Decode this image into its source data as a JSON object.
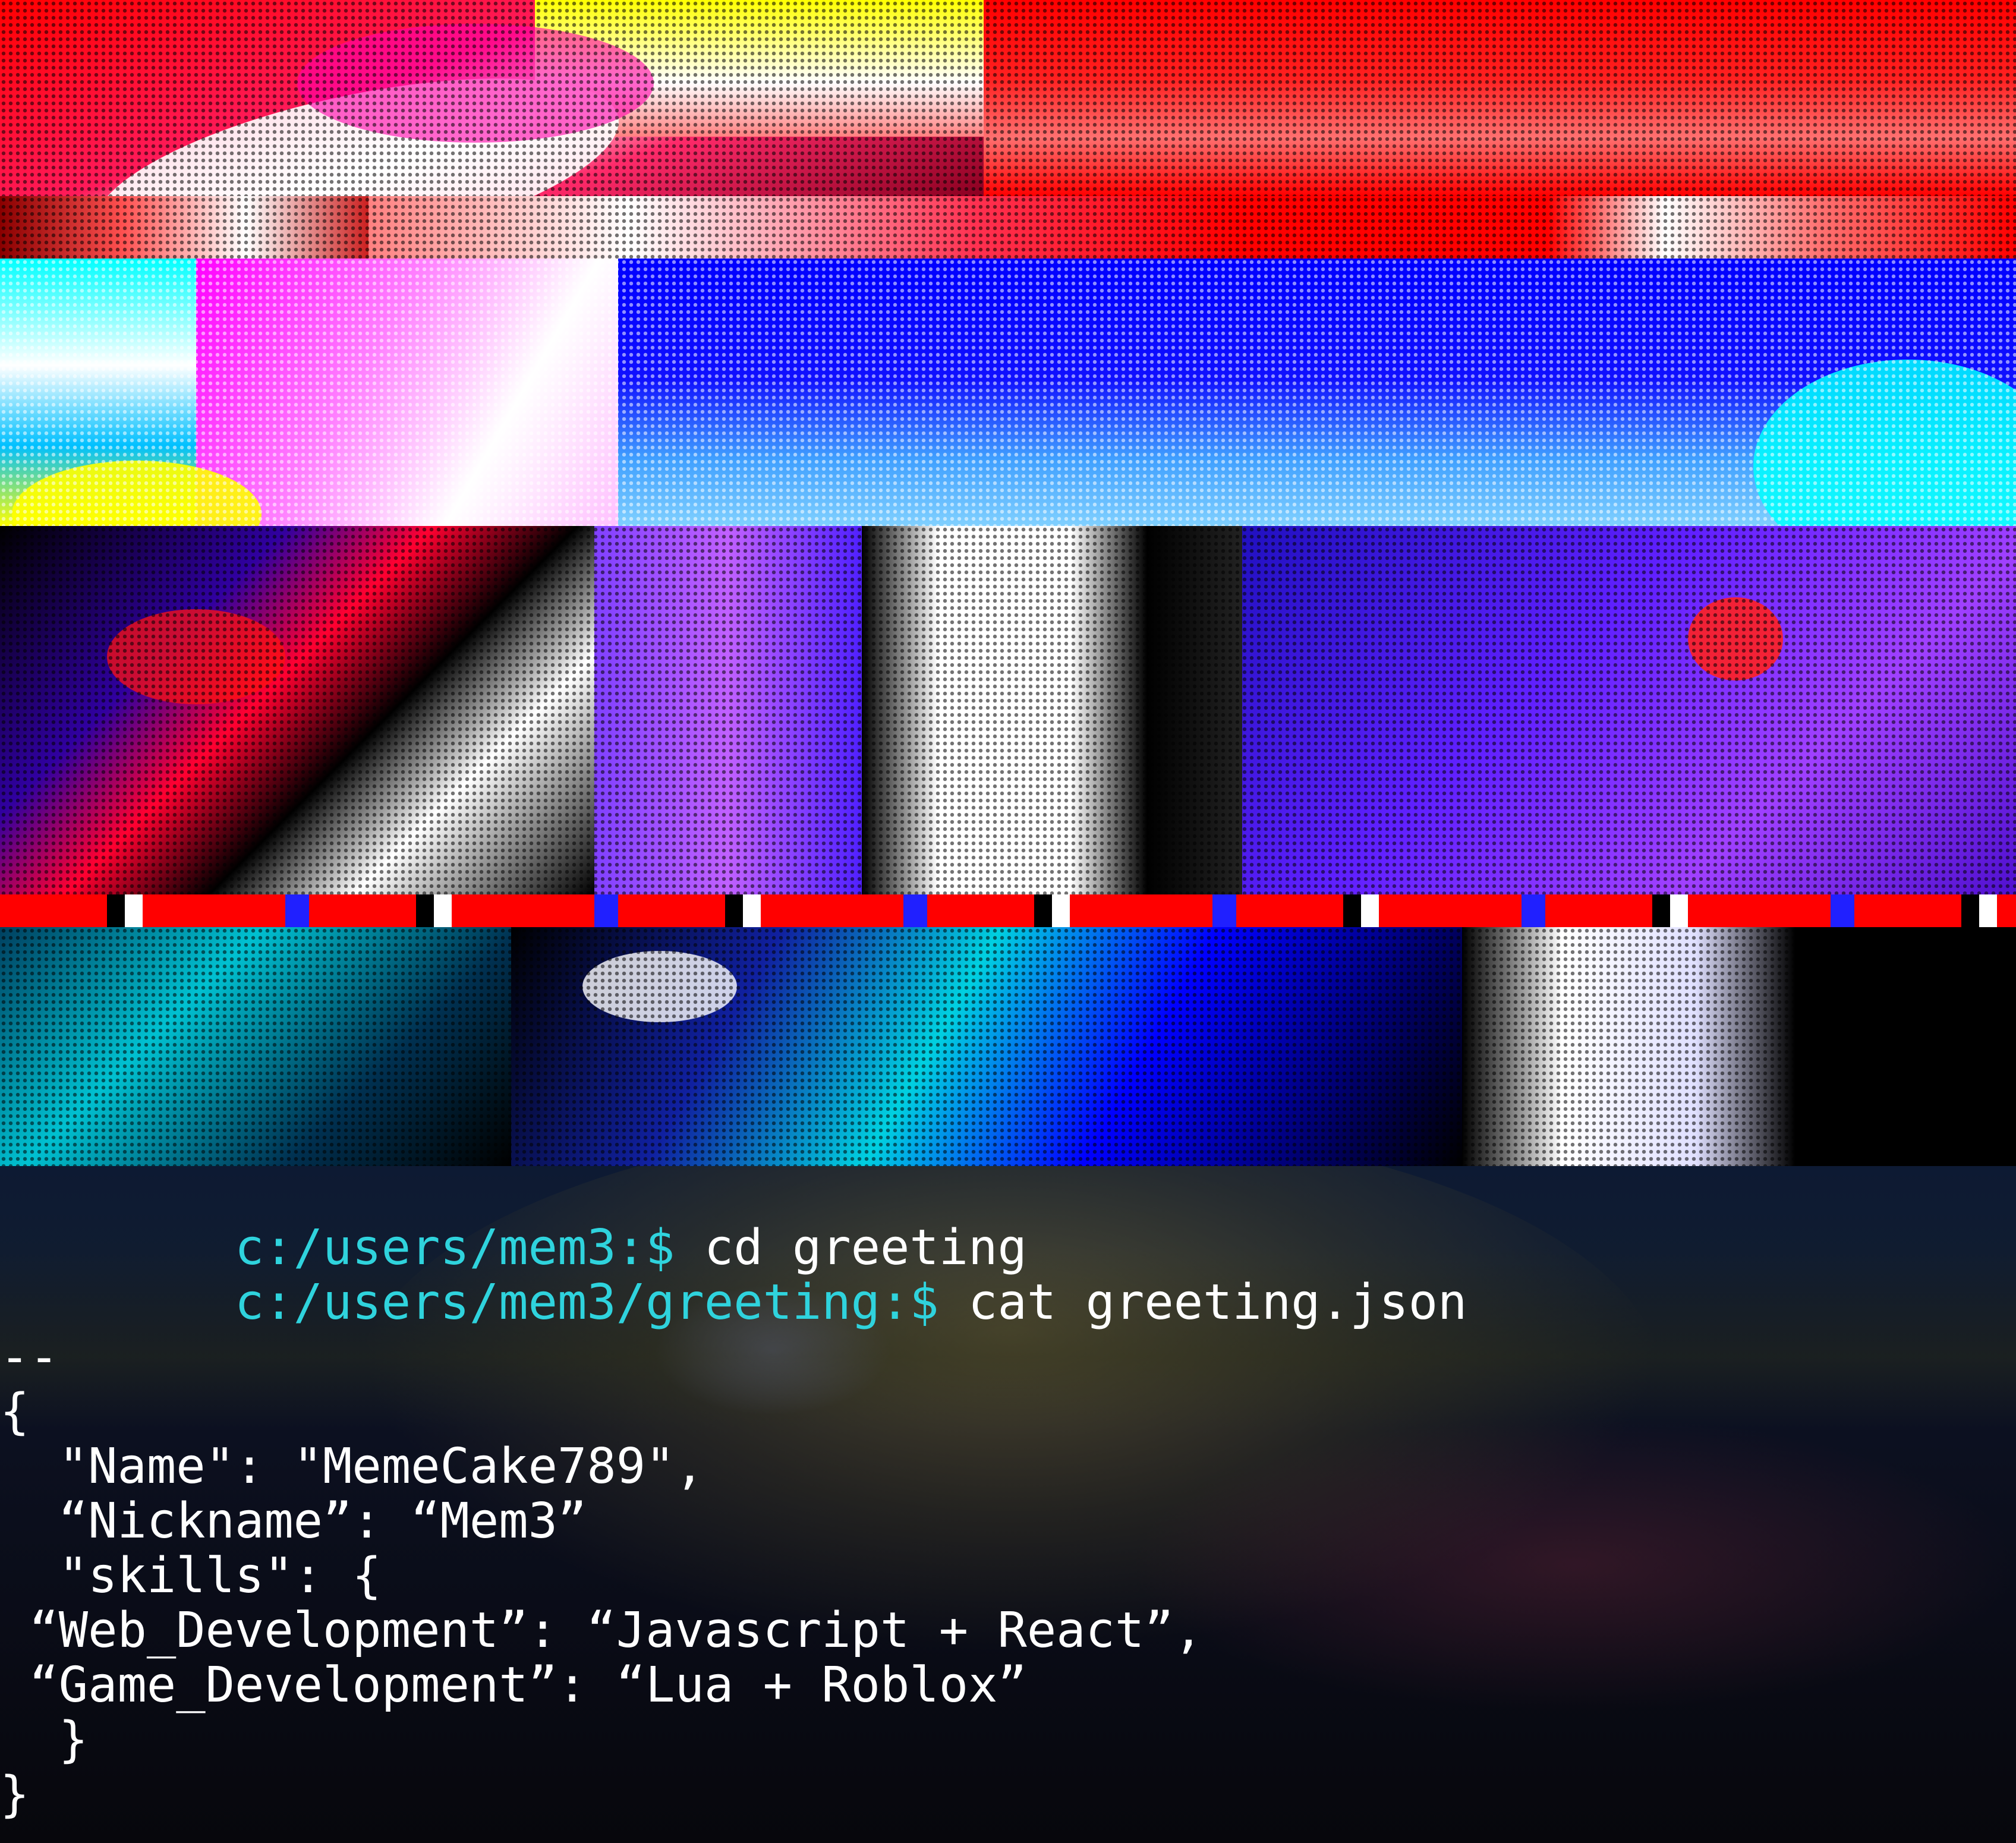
{
  "terminal": {
    "prompt_color": "#2fd3dd",
    "text_color": "#ffffff",
    "lines": [
      {
        "prompt": "c:/users/mem3:$",
        "command": " cd greeting"
      },
      {
        "prompt": "c:/users/mem3/greeting:$",
        "command": " cat greeting.json"
      }
    ],
    "output": [
      "--",
      "{",
      "  \"Name\": \"MemeCake789\",",
      "  “Nickname”: “Mem3”",
      "  \"skills\": {",
      " “Web_Development”: “Javascript + React”,",
      " “Game_Development”: “Lua + Roblox”",
      "  }",
      "}"
    ]
  },
  "banner": {
    "palette": [
      "#ff0000",
      "#0000ff",
      "#00ffff",
      "#ff00ff",
      "#ffffff",
      "#ffff00",
      "#000000"
    ]
  }
}
